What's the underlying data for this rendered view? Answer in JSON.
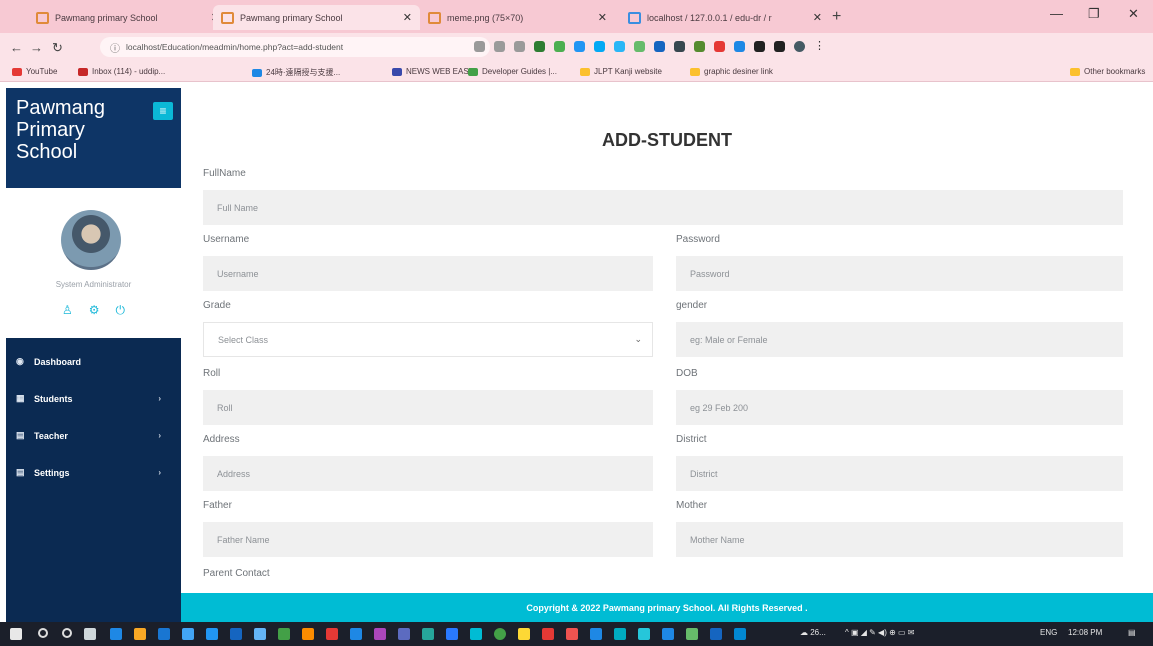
{
  "browser": {
    "tabs": [
      {
        "title": "Pawmang primary School",
        "active": false
      },
      {
        "title": "Pawmang primary School",
        "active": true
      },
      {
        "title": "meme.png (75×70)",
        "active": false
      },
      {
        "title": "localhost / 127.0.0.1 / edu-dr / r",
        "active": false
      }
    ],
    "url": "localhost/Education/meadmin/home.php?act=add-student",
    "bookmarks": [
      "YouTube",
      "Inbox (114) - uddip...",
      "24時·遠隔授与支援...",
      "NEWS WEB EASY",
      "Developer Guides |...",
      "JLPT Kanji website",
      "graphic desiner link",
      "Other bookmarks"
    ]
  },
  "sidebar": {
    "brand": "Pawmang Primary School",
    "role": "System Administrator",
    "nav": [
      {
        "label": "Dashboard",
        "icon": "dashboard-icon",
        "has_children": false
      },
      {
        "label": "Students",
        "icon": "table-icon",
        "has_children": true
      },
      {
        "label": "Teacher",
        "icon": "teacher-icon",
        "has_children": true
      },
      {
        "label": "Settings",
        "icon": "settings-icon",
        "has_children": true
      }
    ]
  },
  "form": {
    "title": "ADD-STUDENT",
    "fullname": {
      "label": "FullName",
      "placeholder": "Full Name"
    },
    "username": {
      "label": "Username",
      "placeholder": "Username"
    },
    "password": {
      "label": "Password",
      "placeholder": "Password"
    },
    "grade": {
      "label": "Grade",
      "value": "Select Class"
    },
    "gender": {
      "label": "gender",
      "placeholder": "eg: Male or Female"
    },
    "roll": {
      "label": "Roll",
      "placeholder": "Roll"
    },
    "dob": {
      "label": "DOB",
      "placeholder": "eg 29 Feb 200"
    },
    "address": {
      "label": "Address",
      "placeholder": "Address"
    },
    "district": {
      "label": "District",
      "placeholder": "District"
    },
    "father": {
      "label": "Father",
      "placeholder": "Father Name"
    },
    "mother": {
      "label": "Mother",
      "placeholder": "Mother Name"
    },
    "parent_contact": {
      "label": "Parent Contact"
    }
  },
  "footer": "Copyright & 2022 Pawmang primary School. All Rights Reserved .",
  "taskbar": {
    "weather": "26...",
    "lang": "ENG",
    "time": "12:08 PM"
  },
  "colors": {
    "sidebar_bg": "#0b2a52",
    "brand_bg": "#0e3566",
    "accent": "#00bcd4",
    "browser_chrome": "#f7c9d3"
  }
}
